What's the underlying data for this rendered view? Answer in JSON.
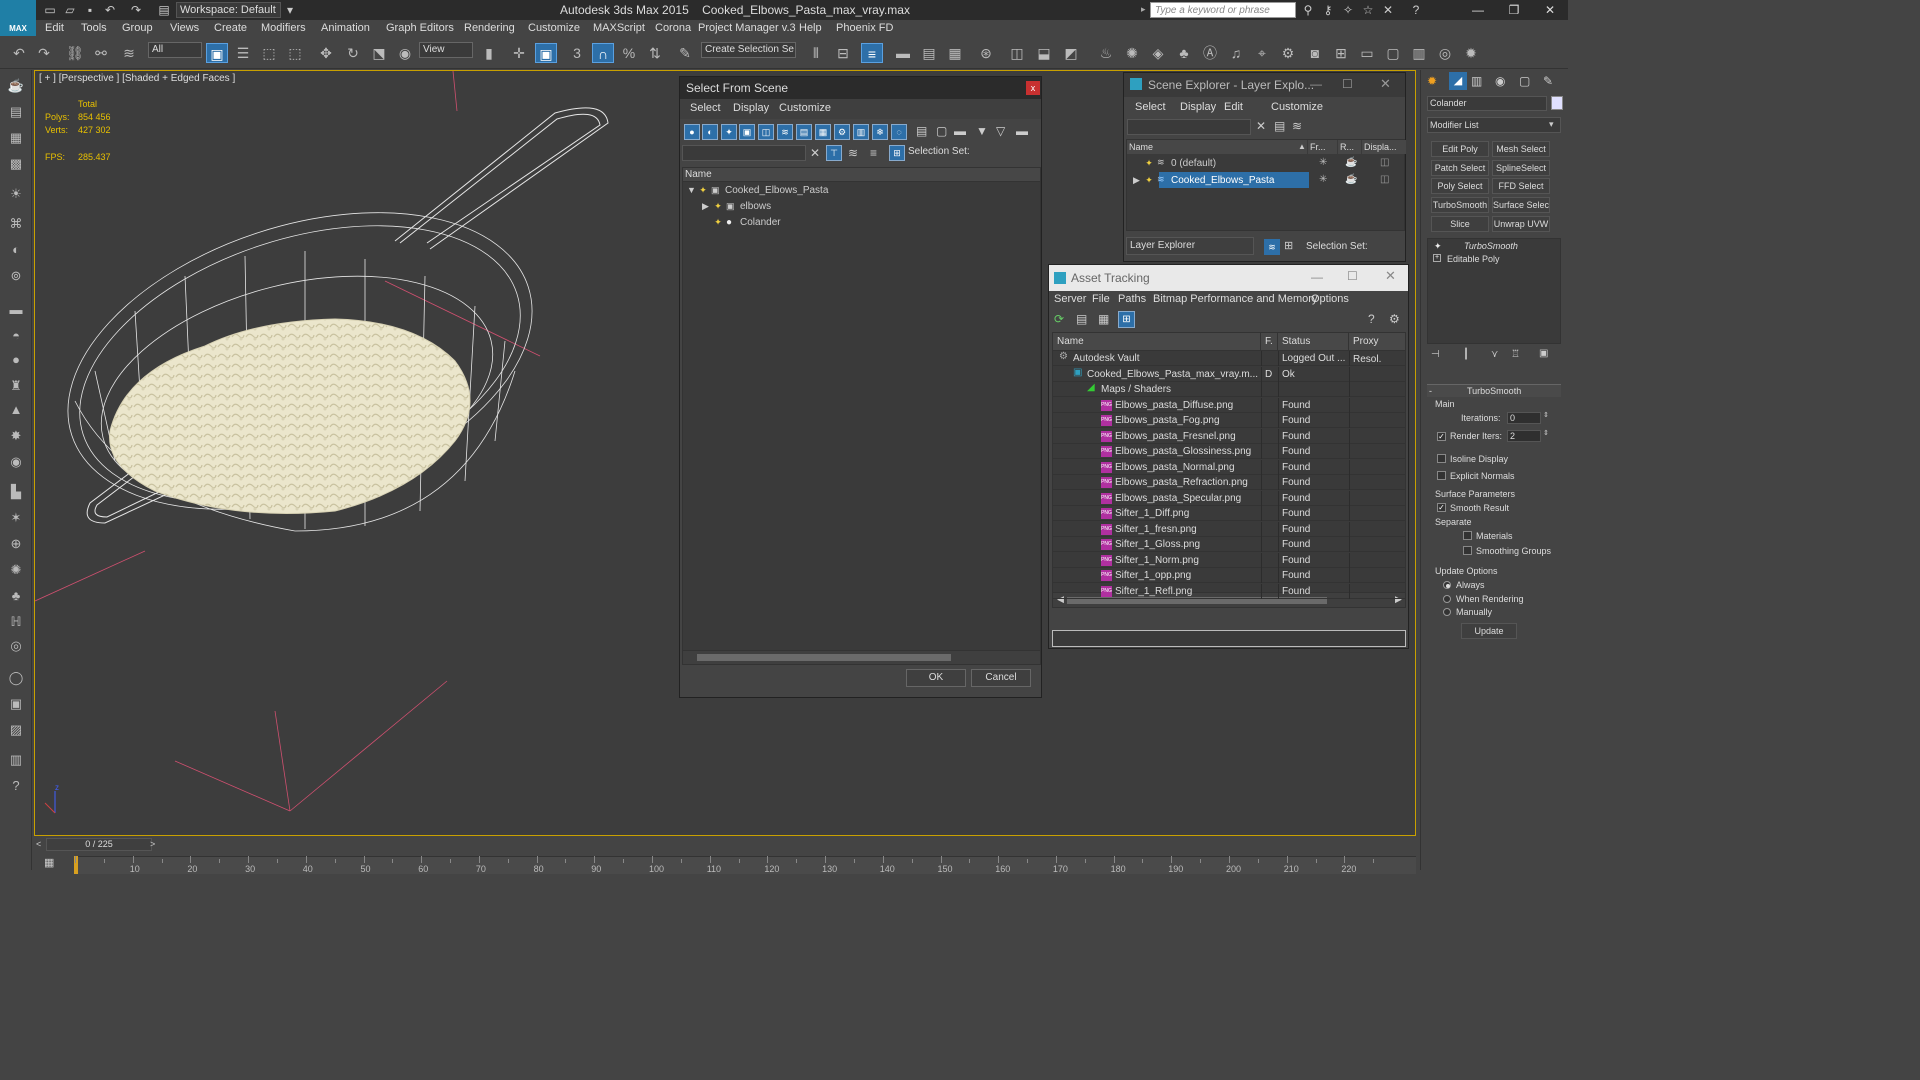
{
  "app": {
    "title_app": "Autodesk 3ds Max  2015",
    "title_file": "Cooked_Elbows_Pasta_max_vray.max",
    "logo_label": "MAX",
    "workspace": "Workspace: Default",
    "search_placeholder": "Type a keyword or phrase"
  },
  "menu": [
    "Edit",
    "Tools",
    "Group",
    "Views",
    "Create",
    "Modifiers",
    "Animation",
    "Graph Editors",
    "Rendering",
    "Customize",
    "MAXScript",
    "Corona",
    "Project Manager v.3",
    "Help",
    "Phoenix FD"
  ],
  "toolbar": {
    "filter": "All",
    "view": "View",
    "create_selection_set": "Create Selection Se"
  },
  "viewport": {
    "label": "[ + ] [Perspective ] [Shaded + Edged Faces ]",
    "stats": {
      "total_label": "Total",
      "polys_label": "Polys:",
      "polys": "854 456",
      "verts_label": "Verts:",
      "verts": "427 302",
      "fps_label": "FPS:",
      "fps": "285.437"
    },
    "axis_z": "z",
    "axis_x": "x"
  },
  "select_from_scene": {
    "title": "Select From Scene",
    "close": "x",
    "menu": [
      "Select",
      "Display",
      "Customize"
    ],
    "selection_set_label": "Selection Set:",
    "column_name": "Name",
    "tree": [
      {
        "label": "Cooked_Elbows_Pasta",
        "level": 0
      },
      {
        "label": "elbows",
        "level": 1
      },
      {
        "label": "Colander",
        "level": 1
      }
    ],
    "ok": "OK",
    "cancel": "Cancel"
  },
  "scene_explorer": {
    "title": "Scene Explorer - Layer Explo...",
    "menu": [
      "Select",
      "Display",
      "Edit",
      "Customize"
    ],
    "columns": [
      "Name",
      "Fr...",
      "R...",
      "Displa..."
    ],
    "rows": [
      "0 (default)",
      "Cooked_Elbows_Pasta"
    ],
    "footer_dropdown": "Layer Explorer",
    "selection_set_label": "Selection Set:"
  },
  "asset_tracking": {
    "title": "Asset Tracking",
    "menu": [
      "Server",
      "File",
      "Paths",
      "Bitmap Performance and Memory",
      "Options"
    ],
    "columns": [
      "Name",
      "F.",
      "Status",
      "Proxy Resol."
    ],
    "rows": [
      {
        "name": "Autodesk Vault",
        "f": "",
        "status": "Logged Out ..."
      },
      {
        "name": "Cooked_Elbows_Pasta_max_vray.m...",
        "f": "D",
        "status": "Ok"
      },
      {
        "name": "Maps / Shaders",
        "f": "",
        "status": ""
      },
      {
        "name": "Elbows_pasta_Diffuse.png",
        "f": "",
        "status": "Found"
      },
      {
        "name": "Elbows_pasta_Fog.png",
        "f": "",
        "status": "Found"
      },
      {
        "name": "Elbows_pasta_Fresnel.png",
        "f": "",
        "status": "Found"
      },
      {
        "name": "Elbows_pasta_Glossiness.png",
        "f": "",
        "status": "Found"
      },
      {
        "name": "Elbows_pasta_Normal.png",
        "f": "",
        "status": "Found"
      },
      {
        "name": "Elbows_pasta_Refraction.png",
        "f": "",
        "status": "Found"
      },
      {
        "name": "Elbows_pasta_Specular.png",
        "f": "",
        "status": "Found"
      },
      {
        "name": "Sifter_1_Diff.png",
        "f": "",
        "status": "Found"
      },
      {
        "name": "Sifter_1_fresn.png",
        "f": "",
        "status": "Found"
      },
      {
        "name": "Sifter_1_Gloss.png",
        "f": "",
        "status": "Found"
      },
      {
        "name": "Sifter_1_Norm.png",
        "f": "",
        "status": "Found"
      },
      {
        "name": "Sifter_1_opp.png",
        "f": "",
        "status": "Found"
      },
      {
        "name": "Sifter_1_Refl.png",
        "f": "",
        "status": "Found"
      }
    ],
    "png_label": "PNG"
  },
  "command_panel": {
    "object_name": "Colander",
    "modifier_list": "Modifier List",
    "buttons": [
      "Edit Poly",
      "Mesh Select",
      "Patch Select",
      "SplineSelect",
      "Poly Select",
      "FFD Select",
      "TurboSmooth",
      "Surface Select",
      "Slice",
      "Unwrap UVW"
    ],
    "stack": [
      "TurboSmooth",
      "Editable Poly"
    ],
    "rollout_title": "TurboSmooth",
    "main_label": "Main",
    "iterations_label": "Iterations:",
    "iterations": "0",
    "render_iters_label": "Render Iters:",
    "render_iters": "2",
    "isoline_display": "Isoline Display",
    "explicit_normals": "Explicit Normals",
    "surface_parameters": "Surface Parameters",
    "smooth_result": "Smooth Result",
    "separate": "Separate",
    "materials": "Materials",
    "smoothing_groups": "Smoothing Groups",
    "update_options": "Update Options",
    "always": "Always",
    "when_rendering": "When Rendering",
    "manually": "Manually",
    "update": "Update"
  },
  "timeline": {
    "frame": "0 / 225",
    "ticks": [
      "10",
      "20",
      "30",
      "40",
      "50",
      "60",
      "70",
      "80",
      "90",
      "100",
      "110",
      "120",
      "130",
      "140",
      "150",
      "160",
      "170",
      "180",
      "190",
      "200",
      "210",
      "220"
    ]
  },
  "colors": {
    "selection_blue": "#2d6fa8",
    "accent_yellow": "#e8c000",
    "png_magenta": "#b030a0"
  }
}
